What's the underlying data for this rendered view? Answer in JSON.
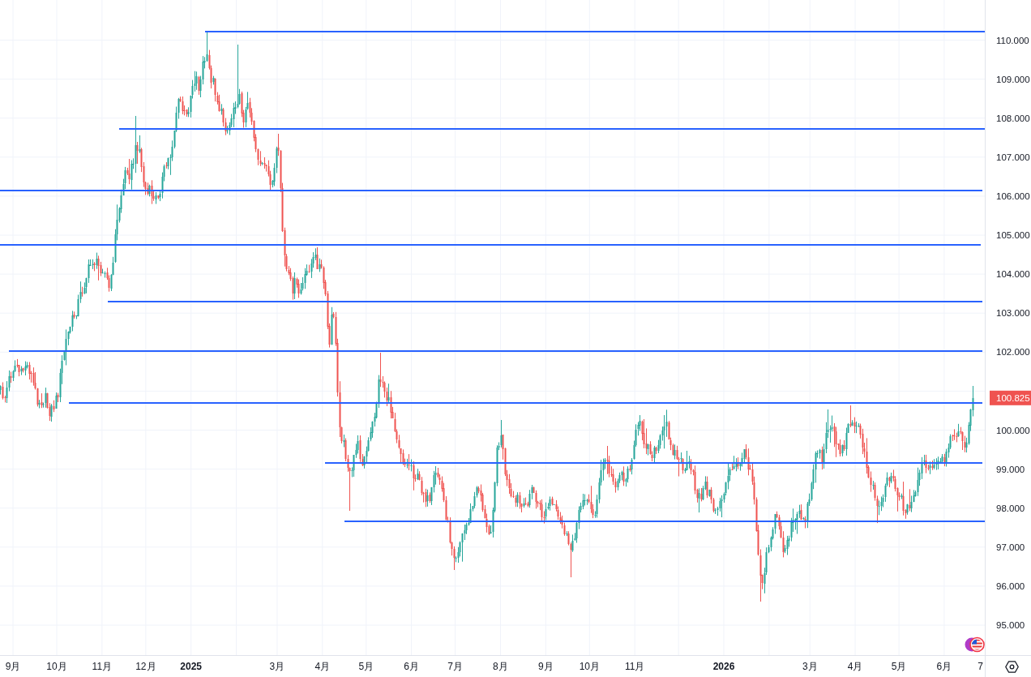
{
  "chart": {
    "price_axis": {
      "labels": [
        "110.000",
        "109.000",
        "108.000",
        "107.000",
        "106.000",
        "105.000",
        "104.000",
        "103.000",
        "102.000",
        "100.000",
        "99.000",
        "98.000",
        "97.000",
        "96.000",
        "95.000"
      ]
    },
    "last_price": {
      "value": "100.825",
      "falling": true
    },
    "time_axis": {
      "labels": [
        {
          "text": "9月",
          "kind": "month"
        },
        {
          "text": "10月",
          "kind": "month"
        },
        {
          "text": "11月",
          "kind": "month"
        },
        {
          "text": "12月",
          "kind": "month"
        },
        {
          "text": "2025",
          "kind": "year"
        },
        {
          "text": "3月",
          "kind": "month"
        },
        {
          "text": "4月",
          "kind": "month"
        },
        {
          "text": "5月",
          "kind": "month"
        },
        {
          "text": "6月",
          "kind": "month"
        },
        {
          "text": "7月",
          "kind": "month"
        },
        {
          "text": "8月",
          "kind": "month"
        },
        {
          "text": "9月",
          "kind": "month"
        },
        {
          "text": "10月",
          "kind": "month"
        },
        {
          "text": "11月",
          "kind": "month"
        },
        {
          "text": "2026",
          "kind": "year"
        },
        {
          "text": "3月",
          "kind": "month"
        },
        {
          "text": "4月",
          "kind": "month"
        },
        {
          "text": "5月",
          "kind": "month"
        },
        {
          "text": "6月",
          "kind": "month"
        },
        {
          "text": "7",
          "kind": "month"
        }
      ]
    }
  }
}
